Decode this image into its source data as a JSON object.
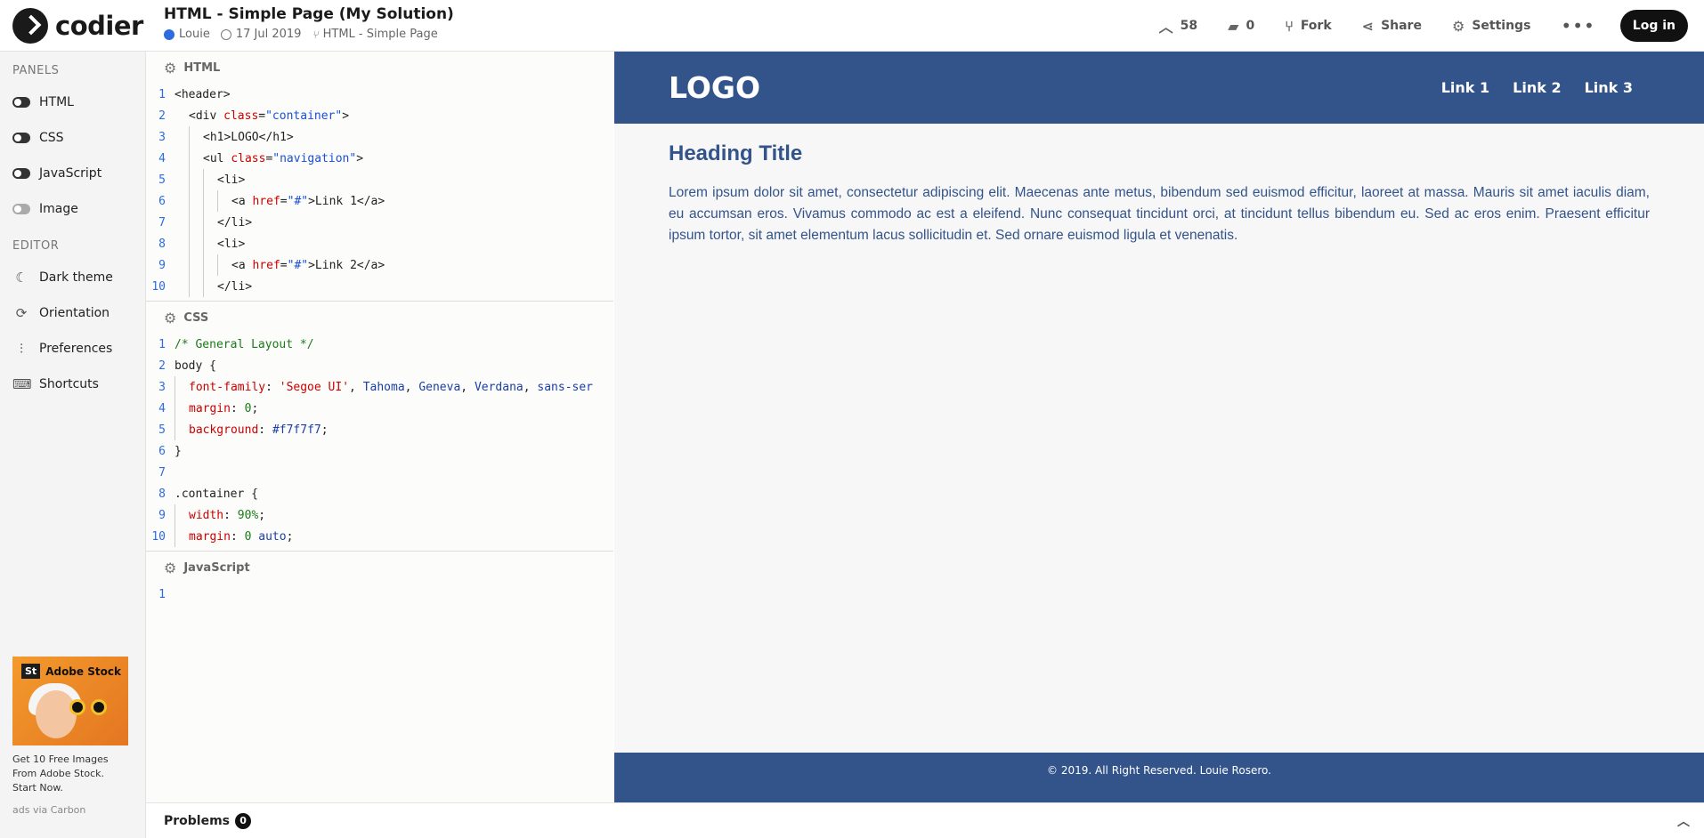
{
  "app": {
    "name": "codier"
  },
  "header": {
    "title": "HTML - Simple Page (My Solution)",
    "author": "Louie",
    "date": "17 Jul 2019",
    "fork_of": "HTML - Simple Page",
    "likes": "58",
    "comments": "0",
    "fork_label": "Fork",
    "share_label": "Share",
    "settings_label": "Settings",
    "login_label": "Log in"
  },
  "sidebar": {
    "panels_heading": "PANELS",
    "panels": [
      {
        "label": "HTML",
        "on": true
      },
      {
        "label": "CSS",
        "on": true
      },
      {
        "label": "JavaScript",
        "on": true
      },
      {
        "label": "Image",
        "on": false
      }
    ],
    "editor_heading": "EDITOR",
    "editor_items": [
      {
        "label": "Dark theme",
        "icon": "moon-icon"
      },
      {
        "label": "Orientation",
        "icon": "rotate-icon"
      },
      {
        "label": "Preferences",
        "icon": "sliders-icon"
      },
      {
        "label": "Shortcuts",
        "icon": "keyboard-icon"
      }
    ],
    "ad": {
      "brand": "Adobe Stock",
      "badge": "St",
      "text": "Get 10 Free Images From Adobe Stock. Start Now.",
      "via": "ads via Carbon"
    }
  },
  "panels": {
    "html_title": "HTML",
    "css_title": "CSS",
    "js_title": "JavaScript"
  },
  "problems": {
    "label": "Problems",
    "count": "0"
  },
  "preview": {
    "logo": "LOGO",
    "links": [
      "Link 1",
      "Link 2",
      "Link 3"
    ],
    "heading": "Heading Title",
    "paragraph": "Lorem ipsum dolor sit amet, consectetur adipiscing elit. Maecenas ante metus, bibendum sed euismod efficitur, laoreet at massa. Mauris sit amet iaculis diam, eu accumsan eros. Vivamus commodo ac est a eleifend. Nunc consequat tincidunt orci, at tincidunt tellus bibendum eu. Sed ac eros enim. Praesent efficitur ipsum tortor, sit amet elementum lacus sollicitudin et. Sed ornare euismod ligula et venenatis.",
    "footer": "© 2019. All Right Reserved. Louie Rosero."
  },
  "colors": {
    "preview_brand": "#33548b",
    "preview_bg": "#f7f7f7",
    "line_number": "#2d6cdf"
  }
}
